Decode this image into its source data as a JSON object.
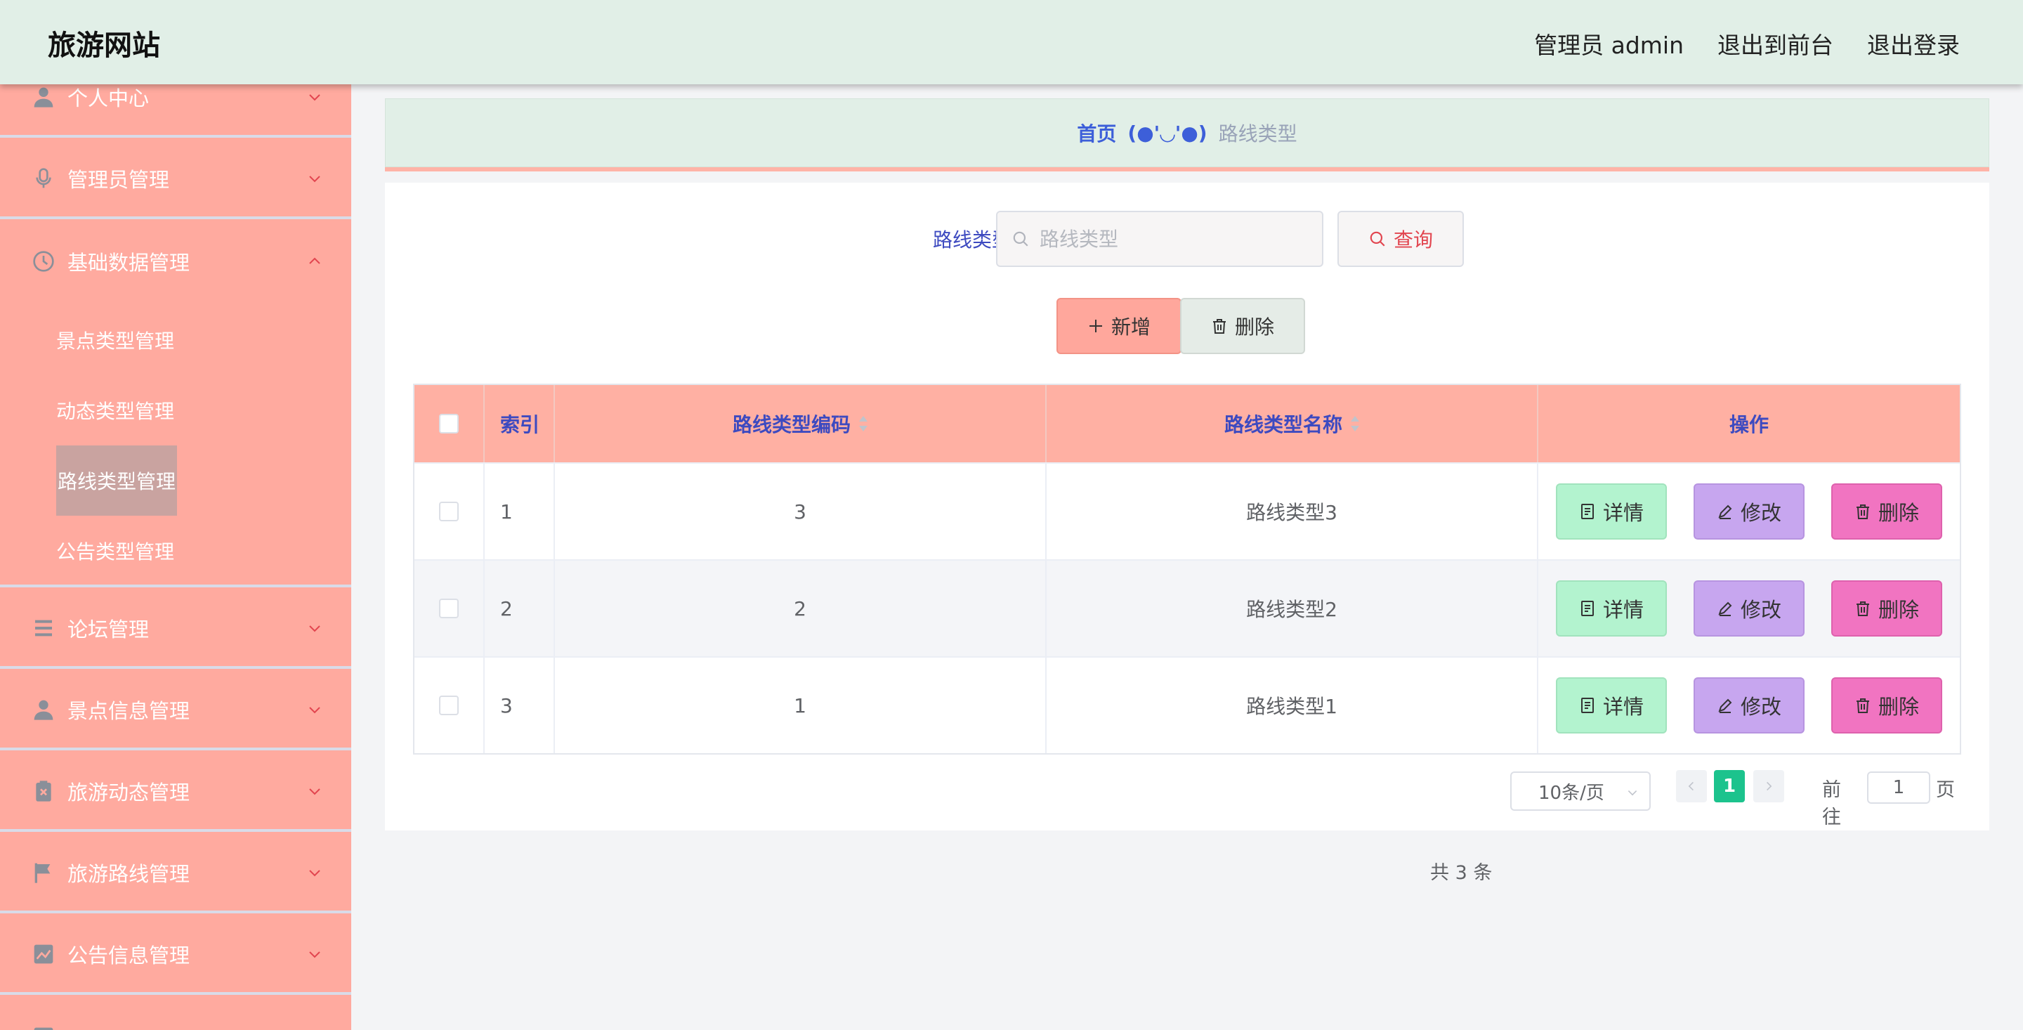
{
  "header": {
    "brand": "旅游网站",
    "nav": {
      "user": "管理员 admin",
      "front": "退出到前台",
      "logout": "退出登录"
    }
  },
  "sidebar": {
    "menus": [
      {
        "label": "个人中心",
        "icon": "person-icon"
      },
      {
        "label": "管理员管理",
        "icon": "microphone-icon"
      },
      {
        "label": "基础数据管理",
        "icon": "clock-icon",
        "expanded": true
      },
      {
        "label": "论坛管理",
        "icon": "list-icon"
      },
      {
        "label": "景点信息管理",
        "icon": "person-icon"
      },
      {
        "label": "旅游动态管理",
        "icon": "clipboard-icon"
      },
      {
        "label": "旅游路线管理",
        "icon": "flag-icon"
      },
      {
        "label": "公告信息管理",
        "icon": "chart-icon"
      }
    ],
    "submenu": [
      {
        "label": "景点类型管理"
      },
      {
        "label": "动态类型管理"
      },
      {
        "label": "路线类型管理",
        "active": true
      },
      {
        "label": "公告类型管理"
      }
    ]
  },
  "breadcrumb": {
    "home": "首页",
    "separator": "(●'◡'●)",
    "current": "路线类型"
  },
  "search": {
    "label": "路线类型",
    "placeholder": "路线类型",
    "query_label": "查询"
  },
  "actions": {
    "add_label": "新增",
    "delete_label": "删除"
  },
  "table": {
    "headers": {
      "index": "索引",
      "code": "路线类型编码",
      "name": "路线类型名称",
      "ops": "操作"
    },
    "rows": [
      {
        "index": "1",
        "code": "3",
        "name": "路线类型3"
      },
      {
        "index": "2",
        "code": "2",
        "name": "路线类型2"
      },
      {
        "index": "3",
        "code": "1",
        "name": "路线类型1"
      }
    ],
    "row_ops": {
      "detail": "详情",
      "edit": "修改",
      "delete": "删除"
    }
  },
  "pagination": {
    "total": "共 3 条",
    "page_size": "10条/页",
    "current_page": "1",
    "goto_label": "前往",
    "goto_value": "1",
    "unit": "页"
  },
  "colors": {
    "header_bg": "#e1efe7",
    "sidebar_bg": "#ffaa9f",
    "table_head_bg": "#ffb0a3",
    "accent_blue": "#3d4ac0",
    "page_active": "#1cc38d"
  }
}
